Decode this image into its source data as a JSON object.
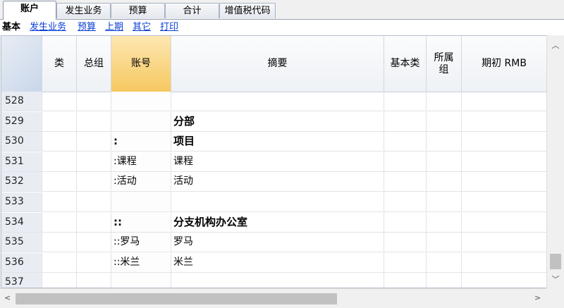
{
  "tabs": [
    {
      "label": "账户",
      "active": true
    },
    {
      "label": "发生业务",
      "active": false
    },
    {
      "label": "预算",
      "active": false
    },
    {
      "label": "合计",
      "active": false
    },
    {
      "label": "增值税代码",
      "active": false
    }
  ],
  "subnav": {
    "current": "基本",
    "links": [
      "发生业务",
      "预算",
      "上期",
      "其它",
      "打印"
    ]
  },
  "columns": [
    {
      "label": ""
    },
    {
      "label": "类"
    },
    {
      "label": "总组"
    },
    {
      "label": "账号"
    },
    {
      "label": "摘要"
    },
    {
      "label": "基本类"
    },
    {
      "label": "所属组"
    },
    {
      "label": "期初 RMB"
    }
  ],
  "rows": [
    {
      "num": "528",
      "account": "",
      "desc": "",
      "bold": false
    },
    {
      "num": "529",
      "account": "",
      "desc": "分部",
      "bold": true
    },
    {
      "num": "530",
      "account": ":",
      "desc": "项目",
      "bold": true
    },
    {
      "num": "531",
      "account": ":课程",
      "desc": "课程",
      "bold": false
    },
    {
      "num": "532",
      "account": ":活动",
      "desc": "活动",
      "bold": false
    },
    {
      "num": "533",
      "account": "",
      "desc": "",
      "bold": false
    },
    {
      "num": "534",
      "account": "::",
      "desc": "分支机构办公室",
      "bold": true
    },
    {
      "num": "535",
      "account": "::罗马",
      "desc": "罗马",
      "bold": false
    },
    {
      "num": "536",
      "account": "::米兰",
      "desc": "米兰",
      "bold": false
    },
    {
      "num": "537",
      "account": "",
      "desc": "",
      "bold": false
    }
  ],
  "icons": {
    "scroll_up": "chevron-up-icon",
    "scroll_down": "chevron-down-icon",
    "scroll_left": "chevron-left-icon",
    "scroll_right": "chevron-right-icon"
  }
}
